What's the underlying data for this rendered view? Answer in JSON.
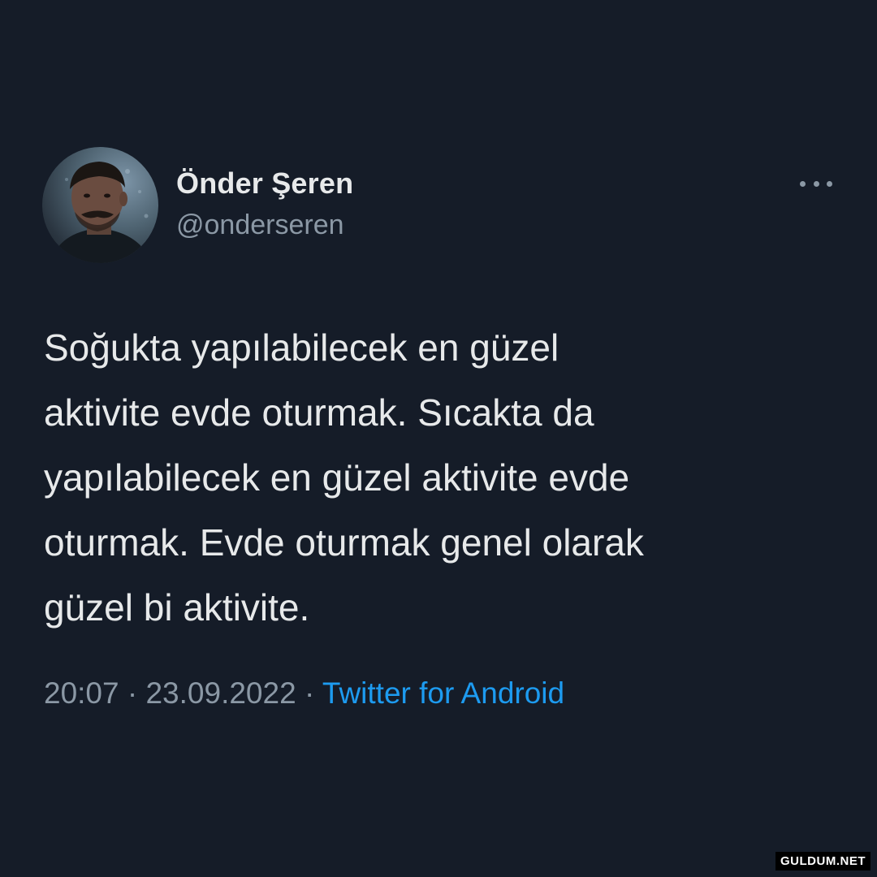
{
  "tweet": {
    "author": {
      "display_name": "Önder Şeren",
      "username": "@onderseren"
    },
    "text_lines": [
      "Soğukta yapılabilecek en güzel",
      "aktivite evde oturmak. Sıcakta da",
      "yapılabilecek en güzel aktivite evde",
      "oturmak. Evde oturmak genel olarak",
      "güzel bi aktivite."
    ],
    "time": "20:07",
    "date": "23.09.2022",
    "separator": "·",
    "source": "Twitter for Android",
    "more_icon": "more-horizontal-icon"
  },
  "watermark": {
    "text": "GULDUM.NET"
  },
  "colors": {
    "background": "#151c28",
    "primary_text": "#e7e9ea",
    "secondary_text": "#8b98a5",
    "link": "#1d9bf0"
  }
}
